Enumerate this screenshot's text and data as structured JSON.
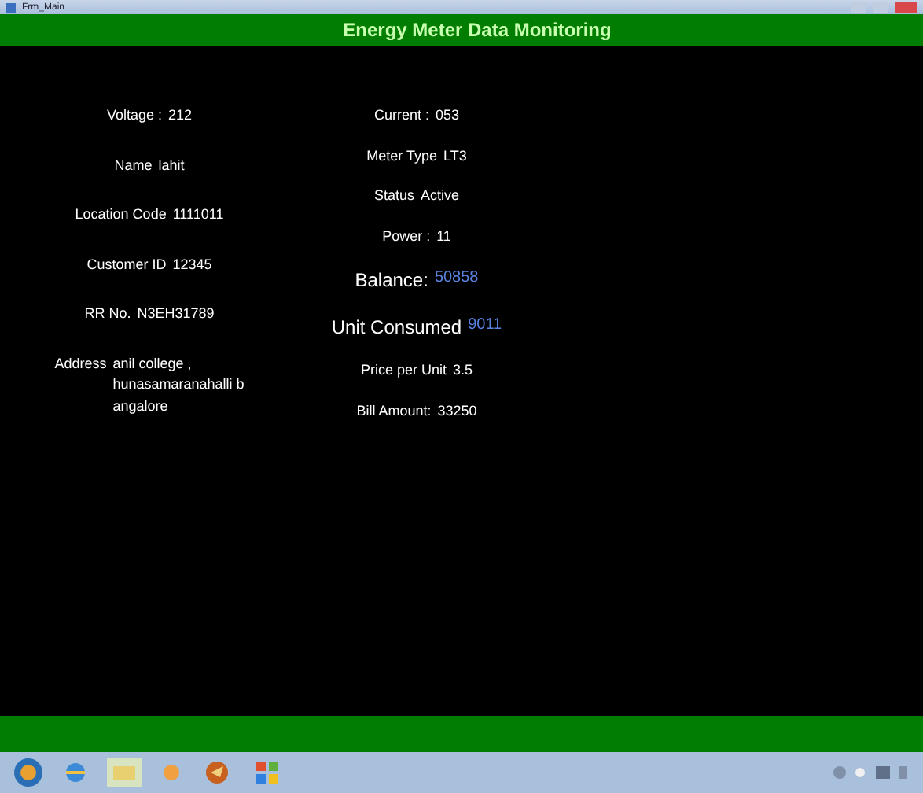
{
  "window": {
    "title": "Frm_Main"
  },
  "header": {
    "title": "Energy Meter Data Monitoring"
  },
  "left_fields": [
    {
      "label": "Voltage :",
      "value": "212",
      "emphasis": false
    },
    {
      "label": "Name",
      "value": "lahit",
      "emphasis": false
    },
    {
      "label": "Location Code",
      "value": "1111011",
      "emphasis": false
    },
    {
      "label": "Customer ID",
      "value": "12345",
      "emphasis": false
    },
    {
      "label": "RR No.",
      "value": "N3EH31789",
      "emphasis": false
    },
    {
      "label": "Address",
      "value": "anil college ,\nhunasamaranahalli b\nangalore",
      "emphasis": false
    }
  ],
  "right_fields": [
    {
      "label": "Current :",
      "value": "053",
      "emphasis": false
    },
    {
      "label": "Meter Type",
      "value": "LT3",
      "emphasis": false
    },
    {
      "label": "Status",
      "value": "Active",
      "emphasis": false
    },
    {
      "label": "Power :",
      "value": "11",
      "emphasis": false
    },
    {
      "label": "Balance:",
      "value": "50858",
      "emphasis": true
    },
    {
      "label": "Unit Consumed",
      "value": "9011",
      "emphasis": true
    },
    {
      "label": "Price per Unit",
      "value": "3.5",
      "emphasis": false
    },
    {
      "label": "Bill Amount:",
      "value": "33250",
      "emphasis": false
    }
  ]
}
